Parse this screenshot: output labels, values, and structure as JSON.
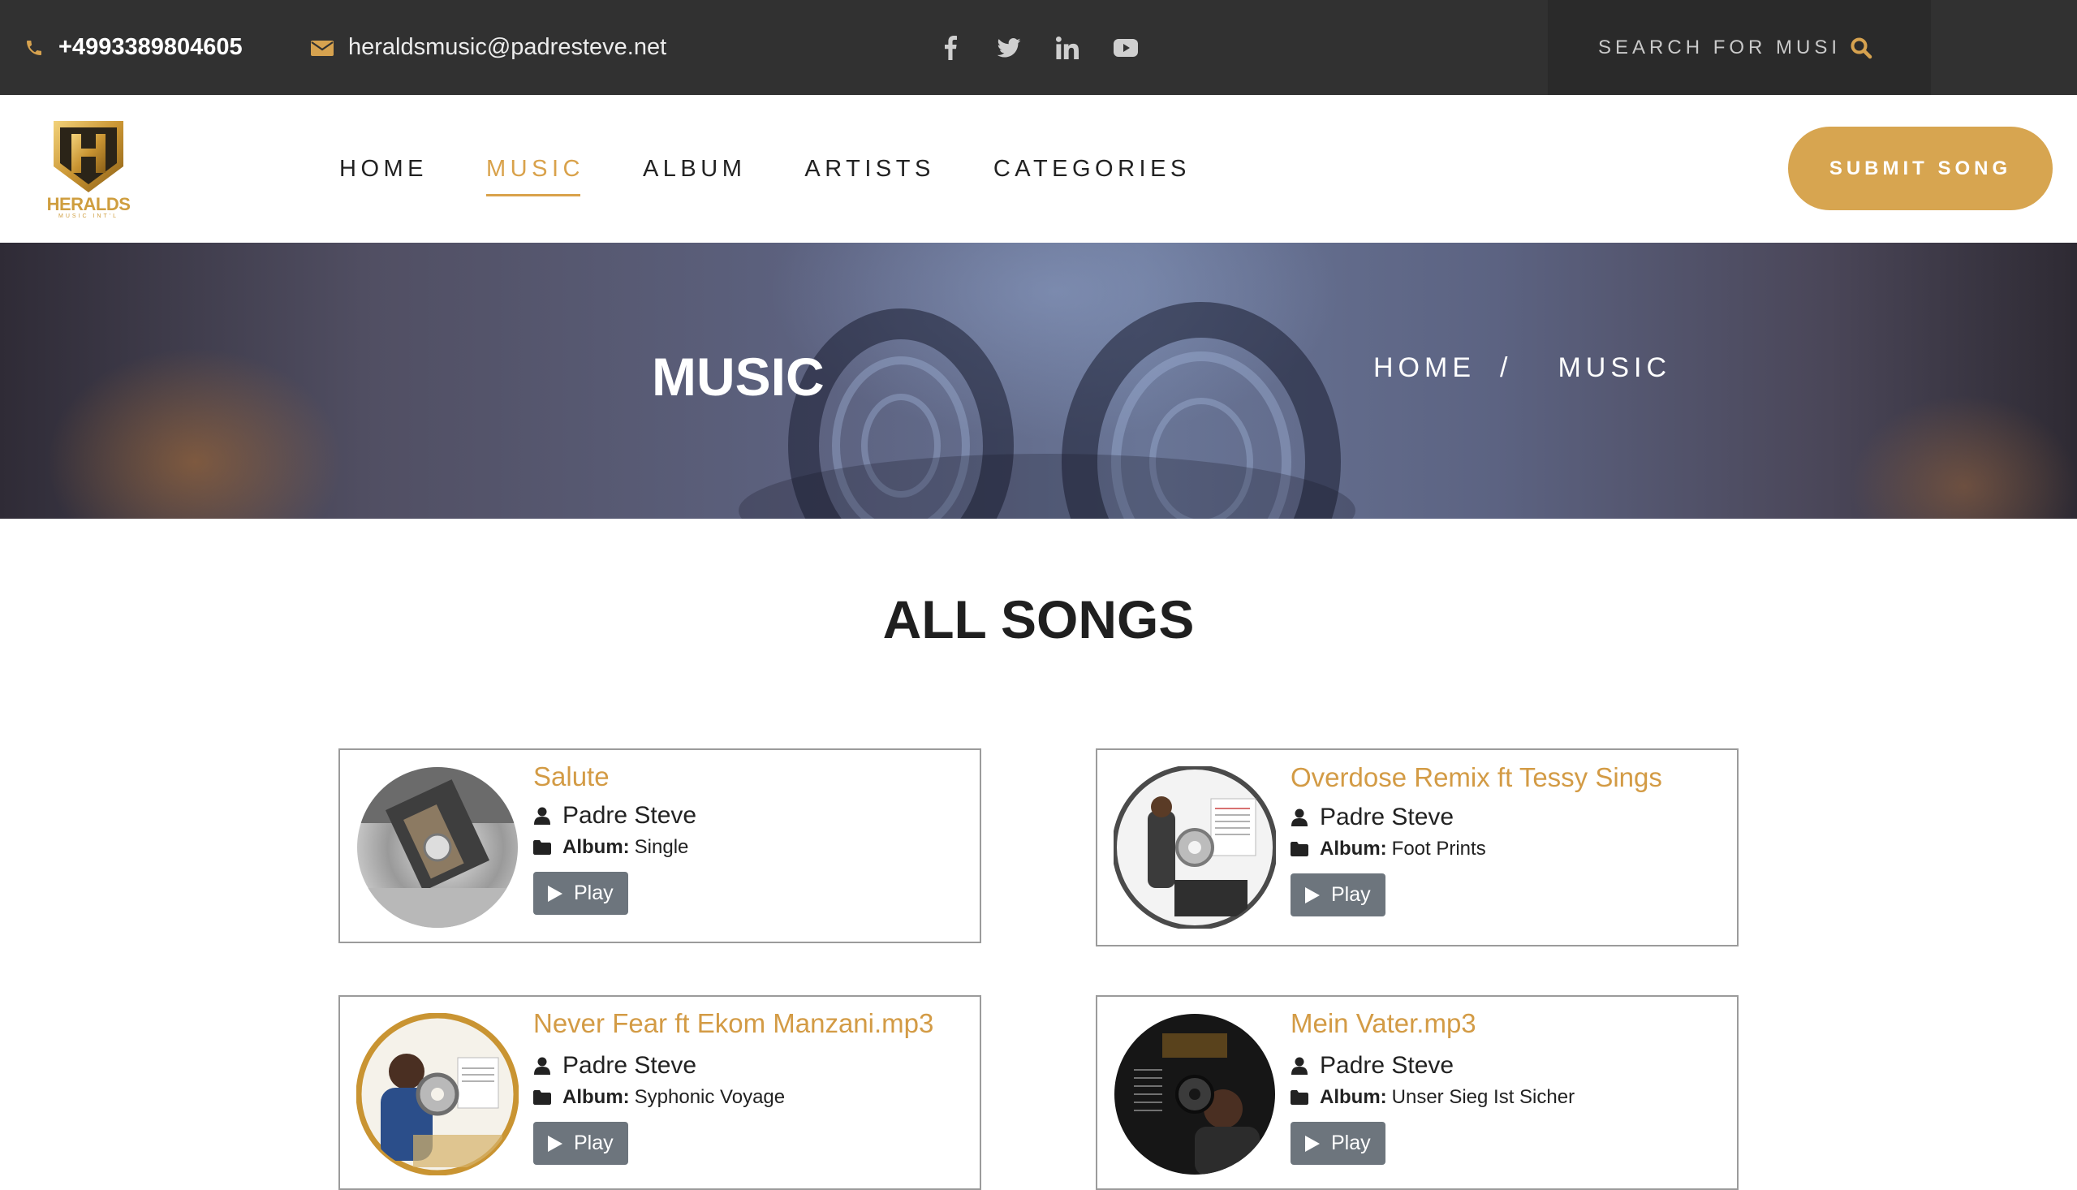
{
  "topbar": {
    "phone": "+4993389804605",
    "email": "heraldsmusic@padresteve.net",
    "socials": [
      "facebook-icon",
      "twitter-icon",
      "linkedin-icon",
      "youtube-icon"
    ],
    "search_placeholder": "SEARCH FOR MUSIC"
  },
  "brand": {
    "name": "HERALDS",
    "tagline": "MUSIC INT'L",
    "gold": "#d7a550",
    "dark": "#313131"
  },
  "nav": {
    "items": [
      {
        "label": "HOME"
      },
      {
        "label": "MUSIC"
      },
      {
        "label": "ALBUM"
      },
      {
        "label": "ARTISTS"
      },
      {
        "label": "CATEGORIES"
      }
    ],
    "active": "MUSIC",
    "submit_label": "SUBMIT SONG"
  },
  "hero": {
    "title": "MUSIC",
    "breadcrumb": [
      "HOME",
      "/",
      "MUSIC"
    ]
  },
  "section": {
    "title": "ALL SONGS"
  },
  "album_label": "Album:",
  "play_label": "Play",
  "songs": [
    {
      "title": "Salute",
      "artist": "Padre Steve",
      "album": "Single"
    },
    {
      "title": "Overdose Remix ft Tessy Sings",
      "artist": "Padre Steve",
      "album": "Foot Prints"
    },
    {
      "title": "Never Fear ft Ekom Manzani.mp3",
      "artist": "Padre Steve",
      "album": "Syphonic Voyage"
    },
    {
      "title": "Mein Vater.mp3",
      "artist": "Padre Steve",
      "album": "Unser Sieg Ist Sicher"
    }
  ]
}
